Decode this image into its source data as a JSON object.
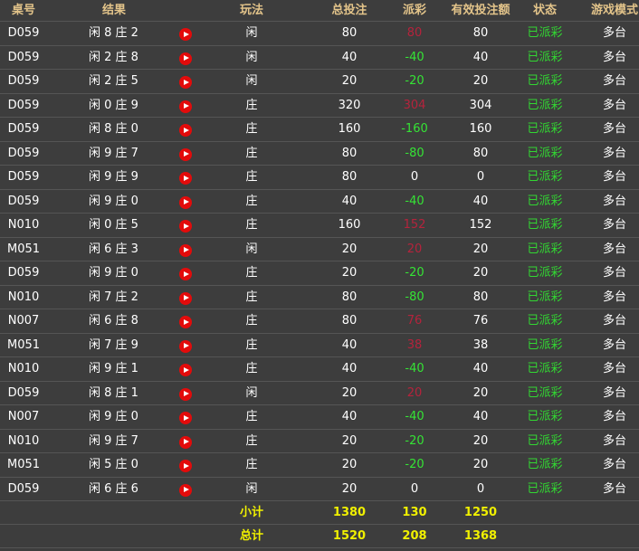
{
  "header": {
    "table": "桌号",
    "result": "结果",
    "play": "玩法",
    "total": "总投注",
    "payout": "派彩",
    "valid": "有效投注额",
    "status": "状态",
    "mode": "游戏模式"
  },
  "rows": [
    {
      "table": "D059",
      "result": "闲 8 庄 2",
      "play": "闲",
      "total": "80",
      "payout": "80",
      "payout_type": "pos",
      "valid": "80",
      "status": "已派彩",
      "mode": "多台"
    },
    {
      "table": "D059",
      "result": "闲 2 庄 8",
      "play": "闲",
      "total": "40",
      "payout": "-40",
      "payout_type": "neg",
      "valid": "40",
      "status": "已派彩",
      "mode": "多台"
    },
    {
      "table": "D059",
      "result": "闲 2 庄 5",
      "play": "闲",
      "total": "20",
      "payout": "-20",
      "payout_type": "neg",
      "valid": "20",
      "status": "已派彩",
      "mode": "多台"
    },
    {
      "table": "D059",
      "result": "闲 0 庄 9",
      "play": "庄",
      "total": "320",
      "payout": "304",
      "payout_type": "pos",
      "valid": "304",
      "status": "已派彩",
      "mode": "多台"
    },
    {
      "table": "D059",
      "result": "闲 8 庄 0",
      "play": "庄",
      "total": "160",
      "payout": "-160",
      "payout_type": "neg",
      "valid": "160",
      "status": "已派彩",
      "mode": "多台"
    },
    {
      "table": "D059",
      "result": "闲 9 庄 7",
      "play": "庄",
      "total": "80",
      "payout": "-80",
      "payout_type": "neg",
      "valid": "80",
      "status": "已派彩",
      "mode": "多台"
    },
    {
      "table": "D059",
      "result": "闲 9 庄 9",
      "play": "庄",
      "total": "80",
      "payout": "0",
      "payout_type": "zero",
      "valid": "0",
      "status": "已派彩",
      "mode": "多台"
    },
    {
      "table": "D059",
      "result": "闲 9 庄 0",
      "play": "庄",
      "total": "40",
      "payout": "-40",
      "payout_type": "neg",
      "valid": "40",
      "status": "已派彩",
      "mode": "多台"
    },
    {
      "table": "N010",
      "result": "闲 0 庄 5",
      "play": "庄",
      "total": "160",
      "payout": "152",
      "payout_type": "pos",
      "valid": "152",
      "status": "已派彩",
      "mode": "多台"
    },
    {
      "table": "M051",
      "result": "闲 6 庄 3",
      "play": "闲",
      "total": "20",
      "payout": "20",
      "payout_type": "pos",
      "valid": "20",
      "status": "已派彩",
      "mode": "多台"
    },
    {
      "table": "D059",
      "result": "闲 9 庄 0",
      "play": "庄",
      "total": "20",
      "payout": "-20",
      "payout_type": "neg",
      "valid": "20",
      "status": "已派彩",
      "mode": "多台"
    },
    {
      "table": "N010",
      "result": "闲 7 庄 2",
      "play": "庄",
      "total": "80",
      "payout": "-80",
      "payout_type": "neg",
      "valid": "80",
      "status": "已派彩",
      "mode": "多台"
    },
    {
      "table": "N007",
      "result": "闲 6 庄 8",
      "play": "庄",
      "total": "80",
      "payout": "76",
      "payout_type": "pos",
      "valid": "76",
      "status": "已派彩",
      "mode": "多台"
    },
    {
      "table": "M051",
      "result": "闲 7 庄 9",
      "play": "庄",
      "total": "40",
      "payout": "38",
      "payout_type": "pos",
      "valid": "38",
      "status": "已派彩",
      "mode": "多台"
    },
    {
      "table": "N010",
      "result": "闲 9 庄 1",
      "play": "庄",
      "total": "40",
      "payout": "-40",
      "payout_type": "neg",
      "valid": "40",
      "status": "已派彩",
      "mode": "多台"
    },
    {
      "table": "D059",
      "result": "闲 8 庄 1",
      "play": "闲",
      "total": "20",
      "payout": "20",
      "payout_type": "pos",
      "valid": "20",
      "status": "已派彩",
      "mode": "多台"
    },
    {
      "table": "N007",
      "result": "闲 9 庄 0",
      "play": "庄",
      "total": "40",
      "payout": "-40",
      "payout_type": "neg",
      "valid": "40",
      "status": "已派彩",
      "mode": "多台"
    },
    {
      "table": "N010",
      "result": "闲 9 庄 7",
      "play": "庄",
      "total": "20",
      "payout": "-20",
      "payout_type": "neg",
      "valid": "20",
      "status": "已派彩",
      "mode": "多台"
    },
    {
      "table": "M051",
      "result": "闲 5 庄 0",
      "play": "庄",
      "total": "20",
      "payout": "-20",
      "payout_type": "neg",
      "valid": "20",
      "status": "已派彩",
      "mode": "多台"
    },
    {
      "table": "D059",
      "result": "闲 6 庄 6",
      "play": "闲",
      "total": "20",
      "payout": "0",
      "payout_type": "zero",
      "valid": "0",
      "status": "已派彩",
      "mode": "多台"
    }
  ],
  "subtotal": {
    "label": "小计",
    "total": "1380",
    "payout": "130",
    "valid": "1250"
  },
  "grandtotal": {
    "label": "总计",
    "total": "1520",
    "payout": "208",
    "valid": "1368"
  },
  "colors": {
    "header": "#e3c48a",
    "positive": "#b5233c",
    "negative": "#35e335",
    "status": "#32d732",
    "summary": "#f0f000",
    "play_icon": "#e30b0b"
  },
  "icons": {
    "video": "play-circle-icon"
  }
}
